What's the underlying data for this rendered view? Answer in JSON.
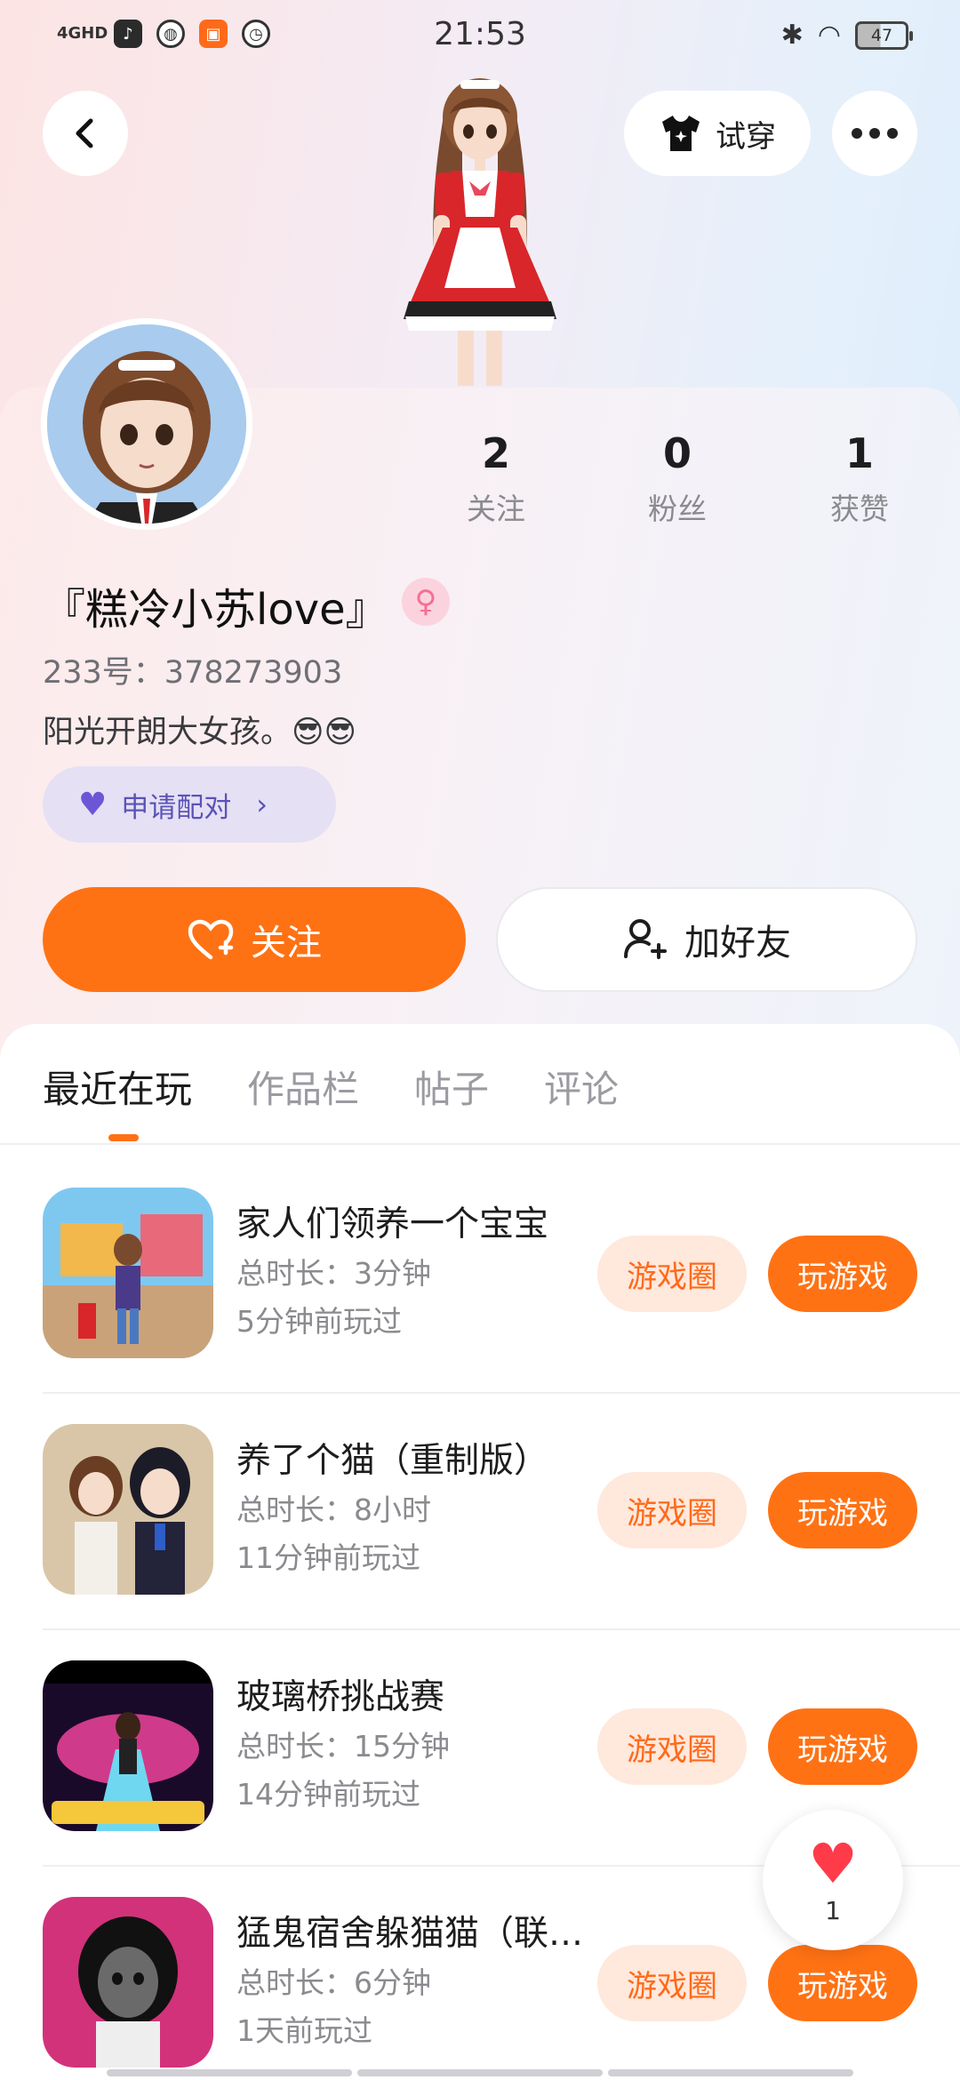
{
  "status_bar": {
    "network": "4GHD",
    "time": "21:53",
    "battery": "47",
    "icons": [
      "douyin-icon",
      "app-icon",
      "app-icon",
      "clock-icon",
      "bluetooth-icon",
      "wifi-icon"
    ]
  },
  "header": {
    "try_on_label": "试穿"
  },
  "profile": {
    "nickname": "『糕冷小苏love』",
    "gender_symbol": "♀",
    "uid": "233号：378273903",
    "bio": "阳光开朗大女孩。😎😎",
    "pair_label": "申请配对",
    "stats": [
      {
        "value": "2",
        "label": "关注"
      },
      {
        "value": "0",
        "label": "粉丝"
      },
      {
        "value": "1",
        "label": "获赞"
      }
    ]
  },
  "actions": {
    "follow_label": "关注",
    "add_friend_label": "加好友"
  },
  "tabs": [
    {
      "label": "最近在玩",
      "active": true
    },
    {
      "label": "作品栏",
      "active": false
    },
    {
      "label": "帖子",
      "active": false
    },
    {
      "label": "评论",
      "active": false
    }
  ],
  "games": [
    {
      "title": "家人们领养一个宝宝",
      "duration": "总时长：3分钟",
      "last_played": "5分钟前玩过",
      "circle_label": "游戏圈",
      "play_label": "玩游戏"
    },
    {
      "title": "养了个猫（重制版）",
      "duration": "总时长：8小时",
      "last_played": "11分钟前玩过",
      "circle_label": "游戏圈",
      "play_label": "玩游戏"
    },
    {
      "title": "玻璃桥挑战赛",
      "duration": "总时长：15分钟",
      "last_played": "14分钟前玩过",
      "circle_label": "游戏圈",
      "play_label": "玩游戏"
    },
    {
      "title": "猛鬼宿舍躲猫猫（联机版）",
      "duration": "总时长：6分钟",
      "last_played": "1天前玩过",
      "circle_label": "游戏圈",
      "play_label": "玩游戏"
    }
  ],
  "like_float": {
    "count": "1"
  },
  "colors": {
    "accent": "#ff7214",
    "accent_light": "#ffe8dc",
    "pair_bg": "#e6e0f5",
    "pair_text": "#5a53b8"
  }
}
